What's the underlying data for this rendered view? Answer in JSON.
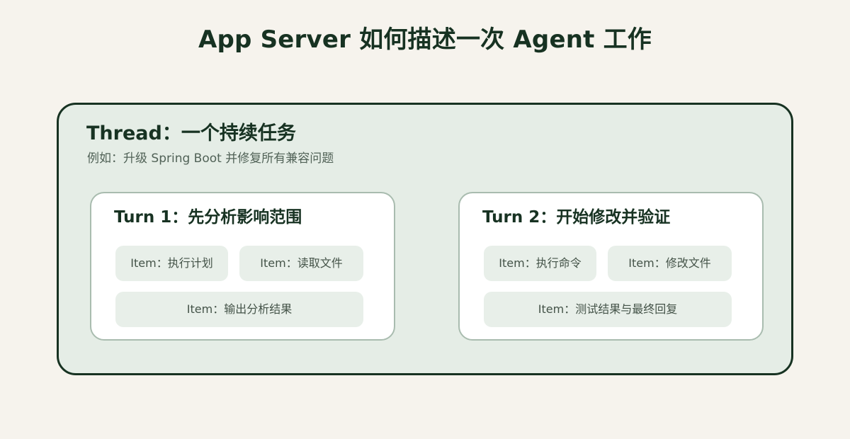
{
  "title": "App Server 如何描述一次 Agent 工作",
  "thread": {
    "title": "Thread：一个持续任务",
    "subtitle": "例如：升级 Spring Boot 并修复所有兼容问题"
  },
  "turns": [
    {
      "title": "Turn 1：先分析影响范围",
      "items": [
        "Item：执行计划",
        "Item：读取文件",
        "Item：输出分析结果"
      ]
    },
    {
      "title": "Turn 2：开始修改并验证",
      "items": [
        "Item：执行命令",
        "Item：修改文件",
        "Item：测试结果与最终回复"
      ]
    }
  ]
}
